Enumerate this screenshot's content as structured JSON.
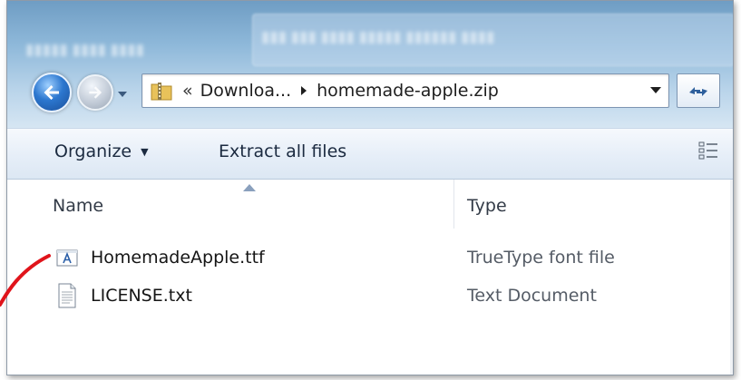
{
  "address_bar": {
    "overflow_symbol": "«",
    "crumbs": [
      "Downloa...",
      "homemade-apple.zip"
    ]
  },
  "command_bar": {
    "organize_label": "Organize",
    "extract_label": "Extract all files"
  },
  "columns": {
    "name": "Name",
    "type": "Type"
  },
  "files": [
    {
      "name": "HomemadeApple.ttf",
      "type": "TrueType font file",
      "icon": "font-file-icon"
    },
    {
      "name": "LICENSE.txt",
      "type": "Text Document",
      "icon": "text-file-icon"
    }
  ],
  "colors": {
    "annotation": "#e0141b",
    "command_bar": "#e6eef8",
    "accent": "#2c77cf"
  }
}
